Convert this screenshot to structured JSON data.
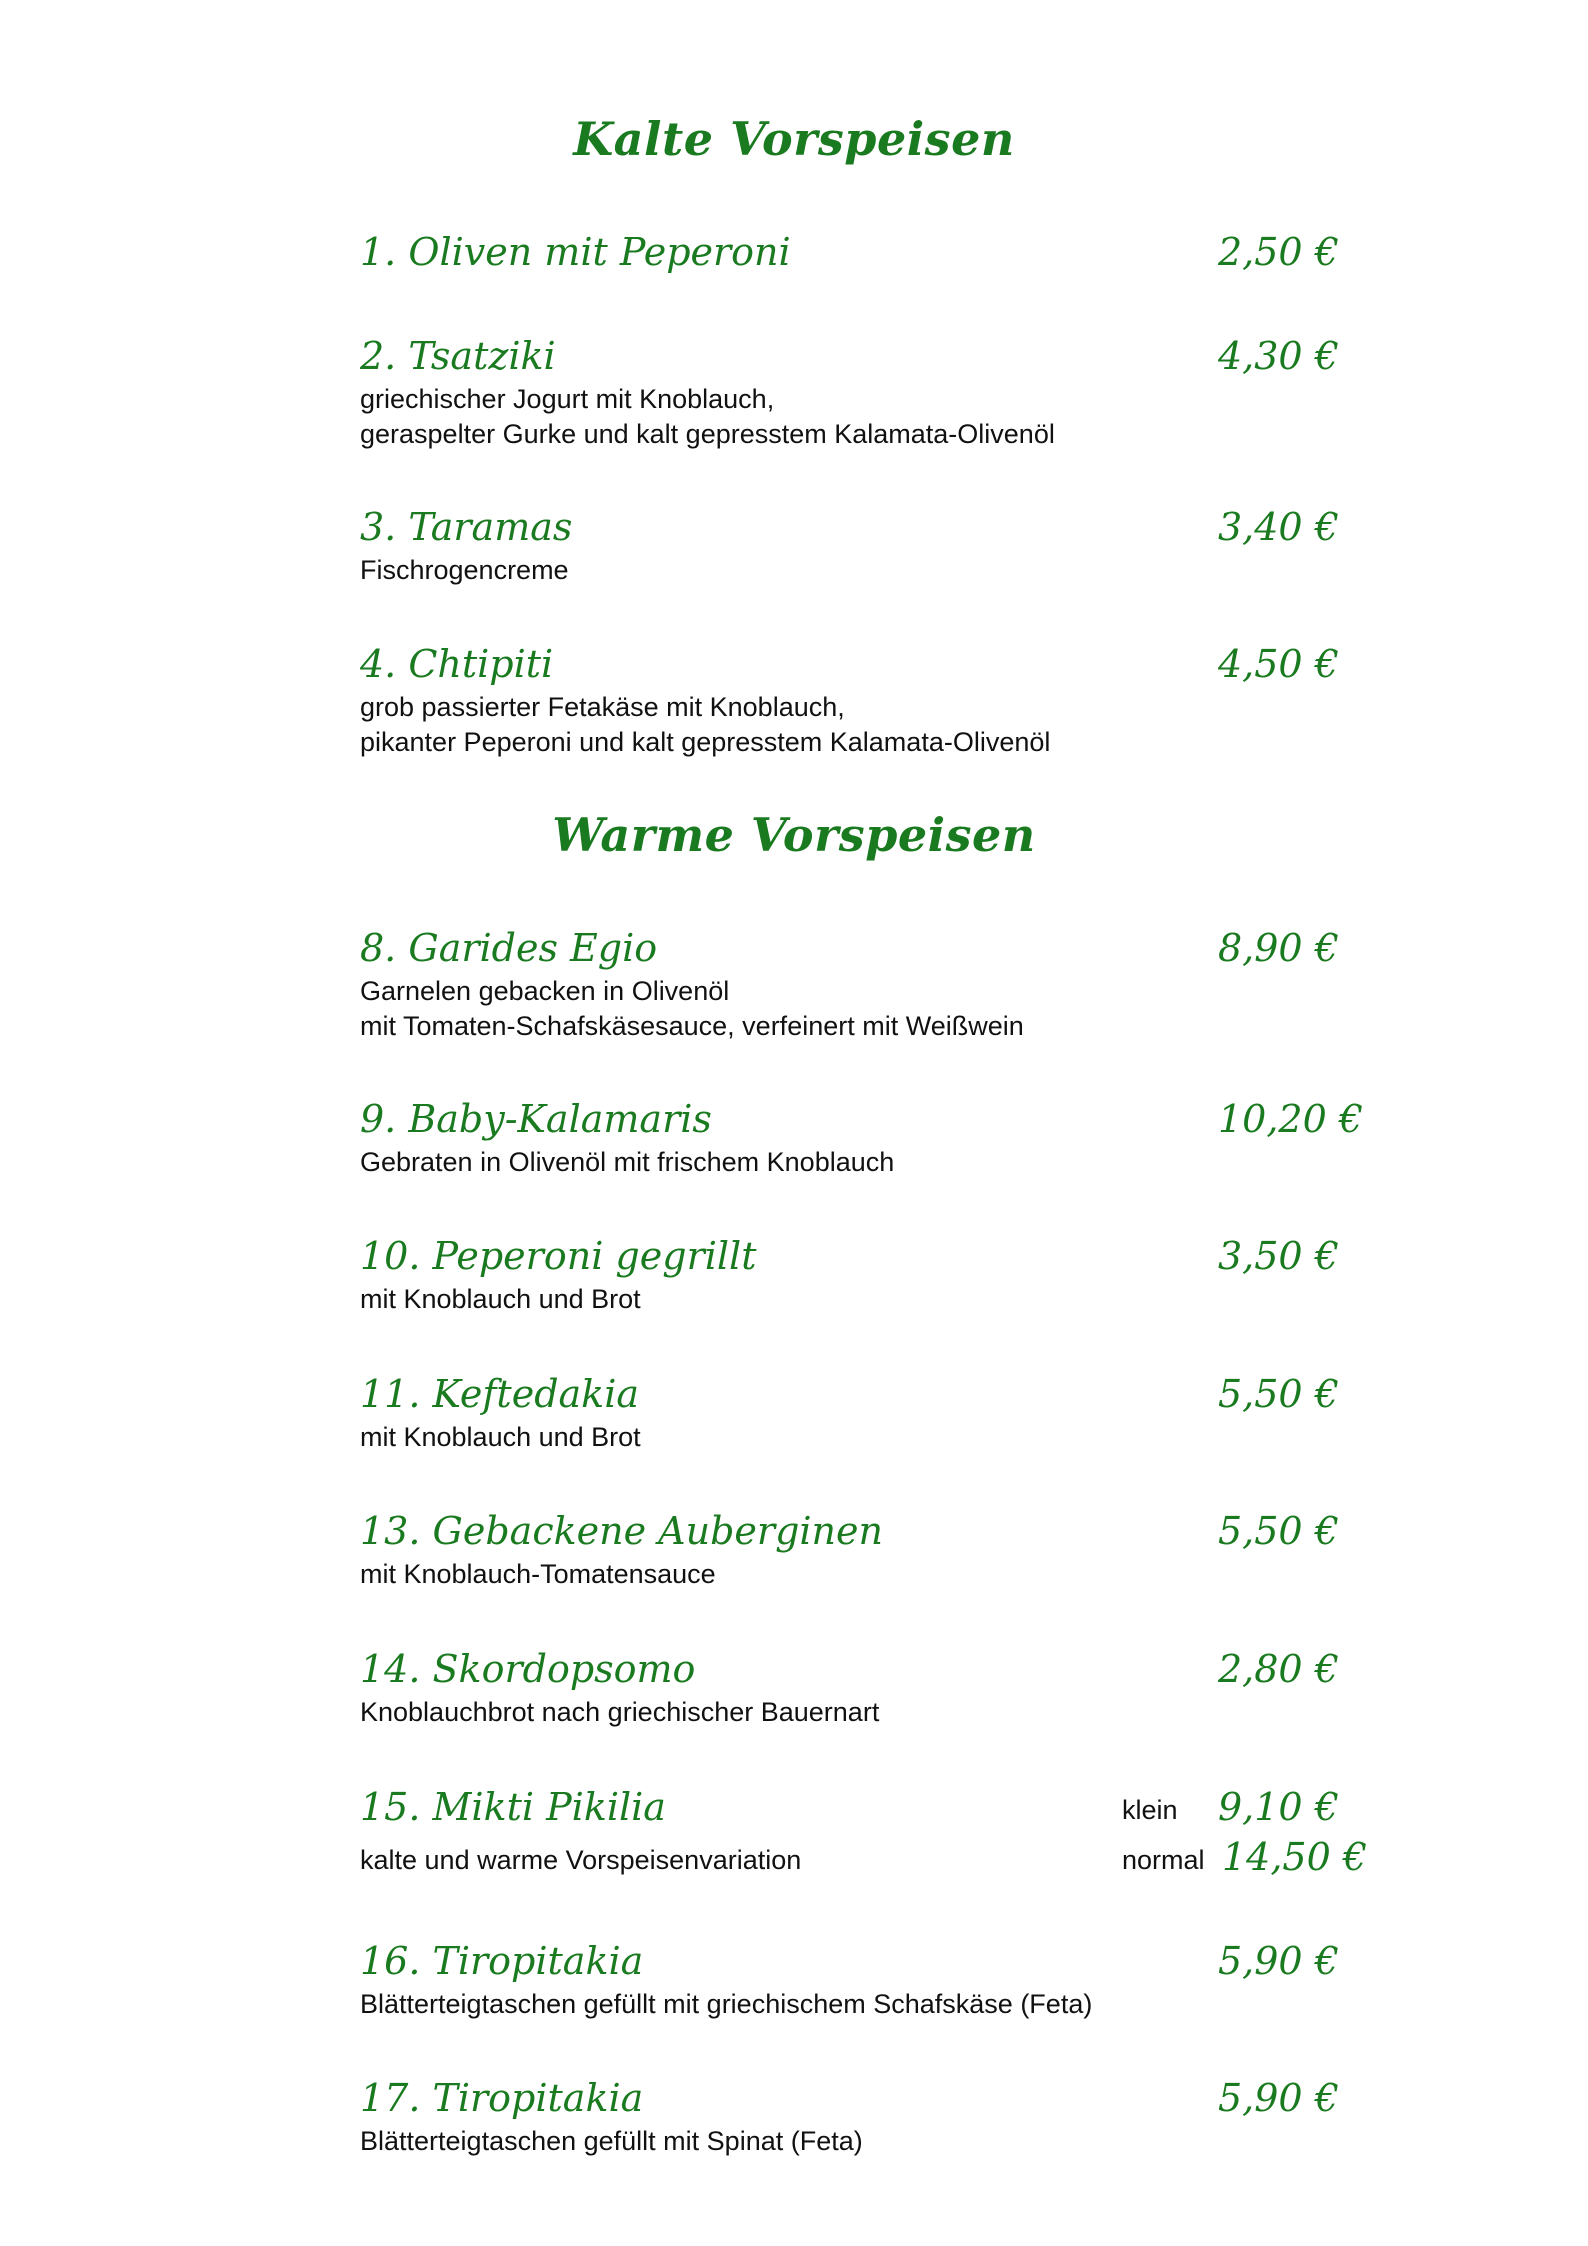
{
  "colors": {
    "heading": "#1a7a1f",
    "text": "#111111",
    "background": "#ffffff"
  },
  "sections": {
    "cold": {
      "title": "Kalte Vorspeisen",
      "items": [
        {
          "name": "1. Oliven mit Peperoni",
          "price": "2,50 €",
          "desc": []
        },
        {
          "name": "2. Tsatziki",
          "price": "4,30 €",
          "desc": [
            "griechischer Jogurt mit Knoblauch,",
            "geraspelter Gurke und kalt gepresstem Kalamata-Olivenöl"
          ]
        },
        {
          "name": "3. Taramas",
          "price": "3,40 €",
          "desc": [
            "Fischrogencreme"
          ]
        },
        {
          "name": "4. Chtipiti",
          "price": "4,50 €",
          "desc": [
            "grob passierter Fetakäse mit Knoblauch,",
            "pikanter Peperoni und kalt gepresstem Kalamata-Olivenöl"
          ]
        }
      ]
    },
    "warm": {
      "title": "Warme Vorspeisen",
      "items": [
        {
          "name": "8. Garides Egio",
          "price": "8,90 €",
          "desc": [
            "Garnelen gebacken in Olivenöl",
            "mit Tomaten-Schafskäsesauce, verfeinert mit Weißwein"
          ]
        },
        {
          "name": "9. Baby-Kalamaris",
          "price": "10,20 €",
          "desc": [
            "Gebraten in Olivenöl mit frischem Knoblauch"
          ]
        },
        {
          "name": "10. Peperoni gegrillt",
          "price": "3,50 €",
          "desc": [
            "mit Knoblauch und Brot"
          ]
        },
        {
          "name": "11. Keftedakia",
          "price": "5,50 €",
          "desc": [
            "mit Knoblauch und Brot"
          ]
        },
        {
          "name": "13. Gebackene Auberginen",
          "price": "5,50 €",
          "desc": [
            "mit Knoblauch-Tomatensauce"
          ]
        },
        {
          "name": "14. Skordopsomo",
          "price": "2,80 €",
          "desc": [
            "Knoblauchbrot nach griechischer Bauernart"
          ]
        },
        {
          "name": "15. Mikti Pikilia",
          "price_small_label": "klein",
          "price_small": "9,10 €",
          "price_normal_label": "normal",
          "price_normal": "14,50 €",
          "desc": [
            "kalte und warme Vorspeisenvariation"
          ]
        },
        {
          "name": "16. Tiropitakia",
          "price": "5,90 €",
          "desc": [
            "Blätterteigtaschen gefüllt mit griechischem Schafskäse (Feta)"
          ]
        },
        {
          "name": "17. Tiropitakia",
          "price": "5,90 €",
          "desc": [
            "Blätterteigtaschen gefüllt mit Spinat (Feta)"
          ]
        }
      ]
    }
  }
}
